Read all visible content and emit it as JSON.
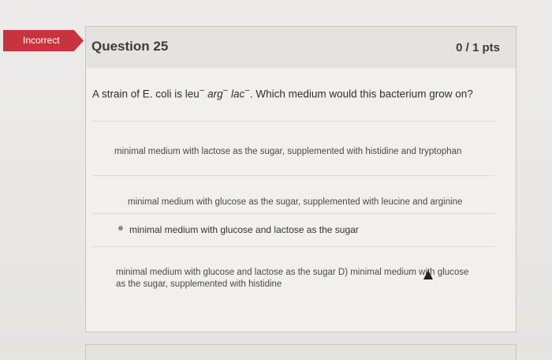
{
  "status": {
    "incorrect_label": "Incorrect",
    "color": "#c8343d"
  },
  "question": {
    "title": "Question 25",
    "points": "0 / 1 pts",
    "text_prefix": "A strain of E. coli is leu",
    "text_sup1": "−",
    "text_arg": "arg",
    "text_sup2": "−",
    "text_lac": "lac",
    "text_sup3": "−",
    "text_suffix": ". Which medium would this bacterium grow on?"
  },
  "answers": [
    {
      "label": "minimal medium with lactose as the sugar, supplemented with histidine and tryptophan"
    },
    {
      "label": "minimal medium with glucose as the sugar, supplemented with leucine and arginine"
    },
    {
      "label": "minimal medium with glucose and lactose as the sugar",
      "selected": true
    },
    {
      "label_line1": "minimal medium with glucose and lactose as the sugar D) minimal medium with glucose",
      "label_line2": "as the sugar, supplemented with histidine"
    }
  ]
}
